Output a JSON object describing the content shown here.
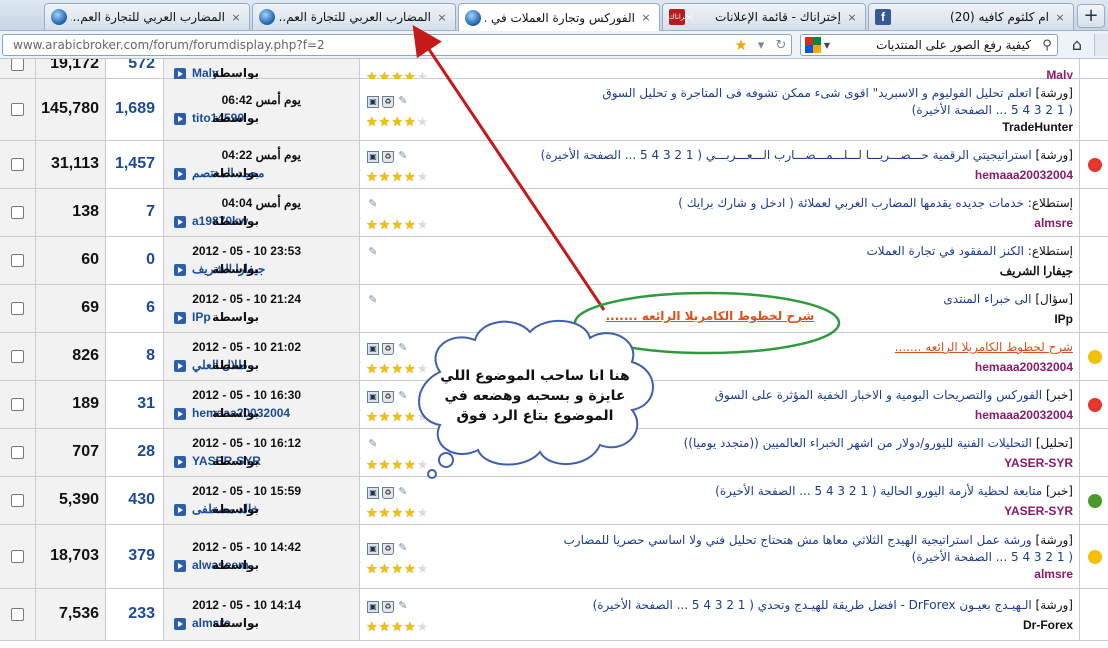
{
  "tabs": [
    {
      "title": "المضارب العربي للتجارة العم...",
      "favicon": "globe-icon"
    },
    {
      "title": "المضارب العربي للتجارة العم...",
      "favicon": "globe-icon"
    },
    {
      "title": "الفوركس وتجارة العملات في ...",
      "favicon": "globe-icon"
    },
    {
      "title": "إختراناك - قائمة الإعلانات",
      "favicon": "ad-icon",
      "favicon_text": "إختراناك"
    },
    {
      "title": "ام كلثوم كافيه (20)",
      "favicon": "facebook-icon",
      "favicon_text": "f"
    }
  ],
  "new_tab_label": "+",
  "tab_close_glyph": "×",
  "address_bar": {
    "url": "www.arabicbroker.com/forum/forumdisplay.php?f=2"
  },
  "search_bar": {
    "query": "كيفية رفع الصور على المنتديات"
  },
  "rows": [
    {
      "views": "19,172",
      "replies": "572",
      "last_time": "",
      "last_by": "بواسطة",
      "last_user": "Maly",
      "title_prefix": "",
      "title": "",
      "pages": "",
      "author": "Maly",
      "author_color": "#8b1a6a",
      "stars": 4,
      "icons": [
        "clip"
      ],
      "edge_color": ""
    },
    {
      "views": "145,780",
      "replies": "1,689",
      "last_time": "يوم أمس 06:42",
      "last_by": "بواسطة",
      "last_user": "tito14590",
      "title_prefix": "[ورشة]",
      "title": "اتعلم تحليل الفوليوم و الاسبريد\" اقوى شىء ممكن تشوفه فى المتاجرة و تحليل السوق",
      "pages": "( 1 2 3 4 5 ... الصفحة الأخيرة)",
      "author": "TradeHunter",
      "author_color": "#111111",
      "stars": 4,
      "icons": [
        "doc",
        "trash",
        "clip"
      ],
      "edge_color": ""
    },
    {
      "views": "31,113",
      "replies": "1,457",
      "last_time": "يوم أمس 04:22",
      "last_by": "بواسطة",
      "last_user": "محمد المعتصم",
      "title_prefix": "[ورشة]",
      "title": "استراتيجيتي الرقمية حـــصـــريـــا لـــلـــمـــضـــارب الـــعـــربـــي ( 1 2 3 4 5 ... الصفحة الأخيرة)",
      "pages": "",
      "author": "hemaaa20032004",
      "author_color": "#8b1a6a",
      "stars": 4,
      "icons": [
        "doc",
        "trash",
        "clip"
      ],
      "edge_color": "#e7352b"
    },
    {
      "views": "138",
      "replies": "7",
      "last_time": "يوم أمس 04:04",
      "last_by": "بواسطة",
      "last_user": "a19870kw",
      "title_prefix": "إستطلاع:",
      "title": "خدمات جديده يقدمها المضارب العربي لعملائة ( ادخل و شارك برايك )",
      "pages": "",
      "author": "almsre",
      "author_color": "#8b1a6a",
      "stars": 4,
      "icons": [
        "clip"
      ],
      "edge_color": ""
    },
    {
      "views": "60",
      "replies": "0",
      "last_time": "2012 - 05 - 10 23:53",
      "last_by": "بواسطة",
      "last_user": "جيفارا الشريف",
      "title_prefix": "إستطلاع:",
      "title": "الكنز المفقود في تجارة العملات",
      "pages": "",
      "author": "جيفارا الشريف",
      "author_color": "#111111",
      "stars": 0,
      "icons": [
        "clip"
      ],
      "edge_color": ""
    },
    {
      "views": "69",
      "replies": "6",
      "last_time": "2012 - 05 - 10 21:24",
      "last_by": "بواسطة",
      "last_user": "IPp",
      "title_prefix": "[سؤال]",
      "title": "الى خبراء المنتدى",
      "pages": "",
      "author": "IPp",
      "author_color": "#111111",
      "stars": 0,
      "icons": [
        "clip"
      ],
      "edge_color": ""
    },
    {
      "views": "826",
      "replies": "8",
      "last_time": "2012 - 05 - 10 21:02",
      "last_by": "بواسطة",
      "last_user": "طلال العلي",
      "title_prefix": "",
      "title": "شرح لخطوط الكامريلا الرائعه .......",
      "title_orange": true,
      "pages": "",
      "author": "hemaaa20032004",
      "author_color": "#8b1a6a",
      "stars": 4,
      "icons": [
        "doc",
        "trash",
        "clip"
      ],
      "edge_color": "#f2c200"
    },
    {
      "views": "189",
      "replies": "31",
      "last_time": "2012 - 05 - 10 16:30",
      "last_by": "بواسطة",
      "last_user": "hemaaa20032004",
      "title_prefix": "[خبر]",
      "title": "الفوركس والتصريحات اليومية و الاخبار الخفية المؤثرة على السوق",
      "pages": "",
      "author": "hemaaa20032004",
      "author_color": "#8b1a6a",
      "stars": 4,
      "icons": [
        "doc",
        "trash",
        "clip"
      ],
      "edge_color": "#e7352b"
    },
    {
      "views": "707",
      "replies": "28",
      "last_time": "2012 - 05 - 10 16:12",
      "last_by": "بواسطة",
      "last_user": "YASER-SYR",
      "title_prefix": "[تحليل]",
      "title": "التحليلات الفنية لليورو/دولار من اشهر الخبراء العالميين ((متجدد يوميا))",
      "pages": "",
      "author": "YASER-SYR",
      "author_color": "#8b1a6a",
      "stars": 4,
      "icons": [
        "clip"
      ],
      "edge_color": ""
    },
    {
      "views": "5,390",
      "replies": "430",
      "last_time": "2012 - 05 - 10 15:59",
      "last_by": "بواسطة",
      "last_user": "خالد مصطفى",
      "title_prefix": "[خبر]",
      "title": "متابعة لحظية لأزمة اليورو الحالية ( 1 2 3 4 5 ... الصفحة الأخيرة)",
      "pages": "",
      "author": "YASER-SYR",
      "author_color": "#8b1a6a",
      "stars": 4,
      "icons": [
        "doc",
        "trash",
        "clip"
      ],
      "edge_color": "#4a9a2a"
    },
    {
      "views": "18,703",
      "replies": "379",
      "last_time": "2012 - 05 - 10 14:42",
      "last_by": "بواسطة",
      "last_user": "alwaseem",
      "title_prefix": "[ورشة]",
      "title": "ورشة عمل استراتيجية الهيدج الثلاثي معاها مش هتحتاج تحليل فني ولا اساسي حصريا للمضارب",
      "pages": "( 1 2 3 4 5 ... الصفحة الأخيرة)",
      "author": "almsre",
      "author_color": "#8b1a6a",
      "stars": 4,
      "icons": [
        "doc",
        "trash",
        "clip"
      ],
      "edge_color": "#f2c200"
    },
    {
      "views": "7,536",
      "replies": "233",
      "last_time": "2012 - 05 - 10 14:14",
      "last_by": "بواسطة",
      "last_user": "almsre",
      "title_prefix": "[ورشة]",
      "title": "الـهيـدج بعيـون DrForex - افضل طريقة للهيـدج وتحدي ( 1 2 3 4 5 ... الصفحة الأخيرة)",
      "pages": "",
      "author": "Dr-Forex",
      "author_color": "#111111",
      "stars": 4,
      "icons": [
        "doc",
        "trash",
        "clip"
      ],
      "edge_color": ""
    }
  ],
  "annotation": {
    "ellipse_label": "شرح لخطوط الكامريلا الرائعه .......",
    "cloud_text": "هنا انا ساحب الموضوع اللي عايزة و بسحبه وهضعه في الموضوع بتاع الرد فوق",
    "arrow_color": "#c41a1a",
    "ellipse_color": "#2e9a3c"
  }
}
